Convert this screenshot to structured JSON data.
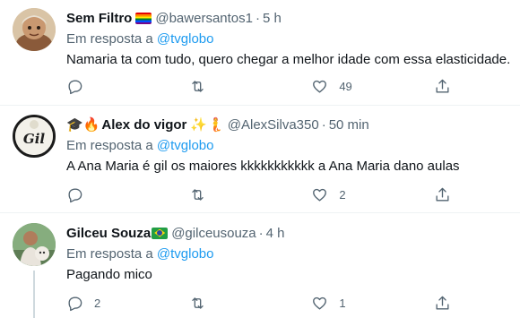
{
  "tweets": [
    {
      "name": "Sem Filtro",
      "badge_icon": "rainbow-flag-icon",
      "handle": "@bawersantos1",
      "separator": "·",
      "time": "5 h",
      "reply_prefix": "Em resposta a",
      "reply_to": "@tvglobo",
      "text": "Namaria ta com tudo, quero chegar a melhor idade com essa elasticidade.",
      "replies": "",
      "retweets": "",
      "likes": "49"
    },
    {
      "name_prefix_emojis": "🎓🔥",
      "name": "Alex do vigor",
      "name_suffix_emojis": "✨🧜",
      "handle": "@AlexSilva350",
      "separator": "·",
      "time": "50 min",
      "reply_prefix": "Em resposta a",
      "reply_to": "@tvglobo",
      "text": "A Ana Maria é gil os maiores kkkkkkkkkkk a Ana Maria dano aulas",
      "replies": "",
      "retweets": "",
      "likes": "2"
    },
    {
      "name": "Gilceu Souza",
      "badge_icon": "brazil-flag-icon",
      "handle": "@gilceusouza",
      "separator": "·",
      "time": "4 h",
      "reply_prefix": "Em resposta a",
      "reply_to": "@tvglobo",
      "text": "Pagando mico",
      "replies": "2",
      "retweets": "",
      "likes": "1"
    }
  ],
  "avatar2_text": "Gil",
  "colors": {
    "link": "#1d9bf0",
    "muted": "#536471",
    "text": "#0f1419",
    "divider": "#eff3f4"
  }
}
